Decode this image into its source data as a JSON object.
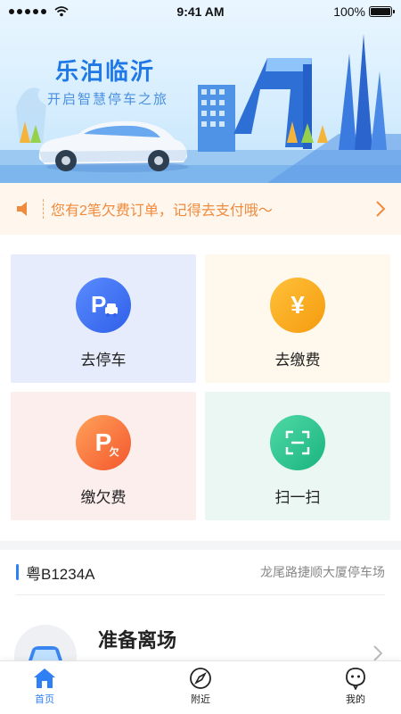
{
  "status_bar": {
    "time": "9:41 AM",
    "battery": "100%",
    "battery_level": 1.0
  },
  "banner": {
    "title": "乐泊临沂",
    "subtitle": "开启智慧停车之旅"
  },
  "notice": {
    "text": "您有2笔欠费订单，记得去支付哦～",
    "icon": "speaker-icon",
    "color": "#f08a3c"
  },
  "tiles": [
    {
      "label": "去停车",
      "icon": "parking-icon",
      "glyph": "P"
    },
    {
      "label": "去缴费",
      "icon": "yuan-icon",
      "glyph": "¥"
    },
    {
      "label": "缴欠费",
      "icon": "arrears-icon",
      "glyph": "P",
      "sub_glyph": "欠"
    },
    {
      "label": "扫一扫",
      "icon": "scan-icon"
    }
  ],
  "parking": {
    "plate": "粤B1234A",
    "lot": "龙尾路捷顺大厦停车场",
    "status": "准备离场"
  },
  "tabbar": {
    "accent": "#2f7ff5",
    "items": [
      {
        "label": "首页",
        "icon": "home-icon",
        "active": true
      },
      {
        "label": "附近",
        "icon": "compass-icon",
        "active": false
      },
      {
        "label": "我的",
        "icon": "profile-icon",
        "active": false
      }
    ]
  }
}
